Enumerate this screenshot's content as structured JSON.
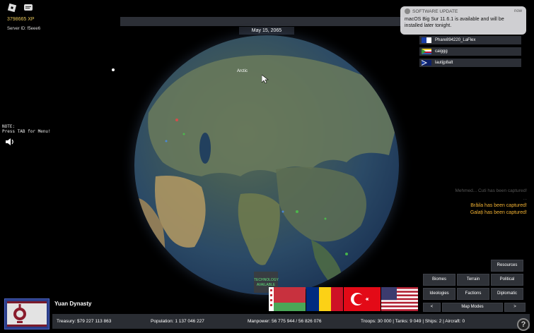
{
  "player": {
    "xp": "3798665 XP",
    "server_id": "Server ID: f5eee6"
  },
  "date": "May 15, 2065",
  "notification": {
    "app": "SOFTWARE UPDATE",
    "time": "now",
    "body": "macOS Big Sur 11.6.1 is available and will be installed later tonight."
  },
  "players_list": [
    {
      "name": "Phare894220_LaFlex"
    },
    {
      "name": "caiggg"
    },
    {
      "name": "lautijp8alt"
    }
  ],
  "note": {
    "line1": "NOTE:",
    "line2": "Press TAB for Menu!"
  },
  "map": {
    "label": "Arctic"
  },
  "events": {
    "faint1": "Mehmed... Cuti has been captured!",
    "faint2": "...",
    "capture1": "Brăila has been captured!",
    "capture2": "Galați has been captured!"
  },
  "technology": {
    "line1": "TECHNOLOGY",
    "line2": "AVAILABLE"
  },
  "buttons": {
    "resources": "Resources",
    "biomes": "Biomes",
    "terrain": "Terrain",
    "political": "Political",
    "ideologies": "Ideologies",
    "factions": "Factions",
    "diplomatic": "Diplomatic",
    "prev": "<",
    "map_modes": "Map Modes",
    "next": ">"
  },
  "nation": {
    "name": "Yuan Dynasty"
  },
  "stats": {
    "treasury": "Treasury:  $79 227 113 863",
    "population": "Population: 1 137 046 227",
    "manpower": "Manpower:  56 775 944  /  56 826 076",
    "troops": "Troops: 30 000  |  Tanks: 9 049  |  Ships: 2  |  Aircraft: 0"
  },
  "help": "?",
  "colors": {
    "panel": "#2c2f36",
    "capture_text": "#f2b233",
    "tech_text": "#5fe07a",
    "emblem_border": "#2a3d88"
  }
}
